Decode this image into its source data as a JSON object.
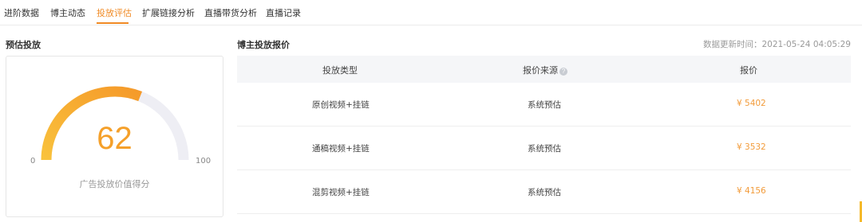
{
  "tabs": [
    {
      "label": "进阶数据",
      "active": false
    },
    {
      "label": "博主动态",
      "active": false
    },
    {
      "label": "投放评估",
      "active": true
    },
    {
      "label": "扩展链接分析",
      "active": false
    },
    {
      "label": "直播带货分析",
      "active": false
    },
    {
      "label": "直播记录",
      "active": false
    }
  ],
  "estimate": {
    "title": "预估投放",
    "score": "62",
    "score_fraction": 0.62,
    "min": "0",
    "max": "100",
    "caption": "广告投放价值得分"
  },
  "quote": {
    "title": "博主投放报价",
    "updated": "数据更新时间：2021-05-24 04:05:29",
    "columns": [
      "投放类型",
      "报价来源",
      "报价"
    ],
    "rows": [
      {
        "type": "原创视频+挂链",
        "source": "系统预估",
        "price": "¥ 5402"
      },
      {
        "type": "通稿视频+挂链",
        "source": "系统预估",
        "price": "¥ 3532"
      },
      {
        "type": "混剪视频+挂链",
        "source": "系统预估",
        "price": "¥ 4156"
      }
    ]
  },
  "colors": {
    "accent": "#f08a24",
    "gauge_start": "#f9c23c",
    "gauge_end": "#f59a2a",
    "gauge_track": "#eeeef4",
    "price": "#f29b3a"
  }
}
